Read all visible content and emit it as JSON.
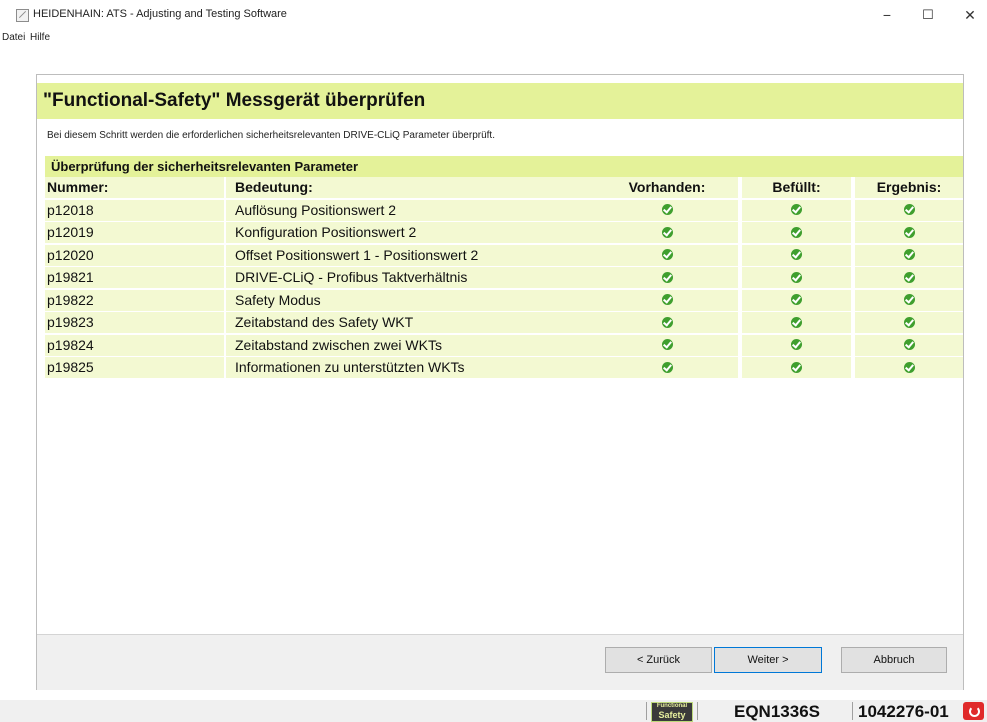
{
  "window": {
    "title": "HEIDENHAIN: ATS - Adjusting and Testing Software",
    "minimize": "−",
    "maximize": "☐",
    "close": "✕"
  },
  "menu": [
    "Datei",
    "Hilfe"
  ],
  "page": {
    "title": "\"Functional-Safety\" Messgerät überprüfen",
    "description": "Bei diesem Schritt werden die erforderlichen sicherheitsrelevanten DRIVE-CLiQ Parameter überprüft.",
    "section_title": "Überprüfung der sicherheitsrelevanten Parameter"
  },
  "table": {
    "headers": [
      "Nummer:",
      "Bedeutung:",
      "Vorhanden:",
      "Befüllt:",
      "Ergebnis:"
    ],
    "rows": [
      {
        "nummer": "p12018",
        "bedeutung": "Auflösung Positionswert 2",
        "vorhanden": "ok",
        "befuellt": "ok",
        "ergebnis": "ok"
      },
      {
        "nummer": "p12019",
        "bedeutung": "Konfiguration Positionswert 2",
        "vorhanden": "ok",
        "befuellt": "ok",
        "ergebnis": "ok"
      },
      {
        "nummer": "p12020",
        "bedeutung": "Offset Positionswert 1 - Positionswert 2",
        "vorhanden": "ok",
        "befuellt": "ok",
        "ergebnis": "ok"
      },
      {
        "nummer": "p19821",
        "bedeutung": "DRIVE-CLiQ - Profibus Taktverhältnis",
        "vorhanden": "ok",
        "befuellt": "ok",
        "ergebnis": "ok"
      },
      {
        "nummer": "p19822",
        "bedeutung": "Safety Modus",
        "vorhanden": "ok",
        "befuellt": "ok",
        "ergebnis": "ok"
      },
      {
        "nummer": "p19823",
        "bedeutung": "Zeitabstand des Safety WKT",
        "vorhanden": "ok",
        "befuellt": "ok",
        "ergebnis": "ok"
      },
      {
        "nummer": "p19824",
        "bedeutung": "Zeitabstand zwischen zwei WKTs",
        "vorhanden": "ok",
        "befuellt": "ok",
        "ergebnis": "ok"
      },
      {
        "nummer": "p19825",
        "bedeutung": "Informationen zu unterstützten WKTs",
        "vorhanden": "ok",
        "befuellt": "ok",
        "ergebnis": "ok"
      }
    ]
  },
  "buttons": {
    "back": "< Zurück",
    "next": "Weiter >",
    "cancel": "Abbruch"
  },
  "status": {
    "logo_line1": "Functional",
    "logo_line2": "Safety",
    "device": "EQN1336S",
    "id": "1042276-01"
  },
  "colors": {
    "header_bg": "#e4f299",
    "row_bg": "#f3f9d2",
    "check": "#3f9f2e"
  }
}
